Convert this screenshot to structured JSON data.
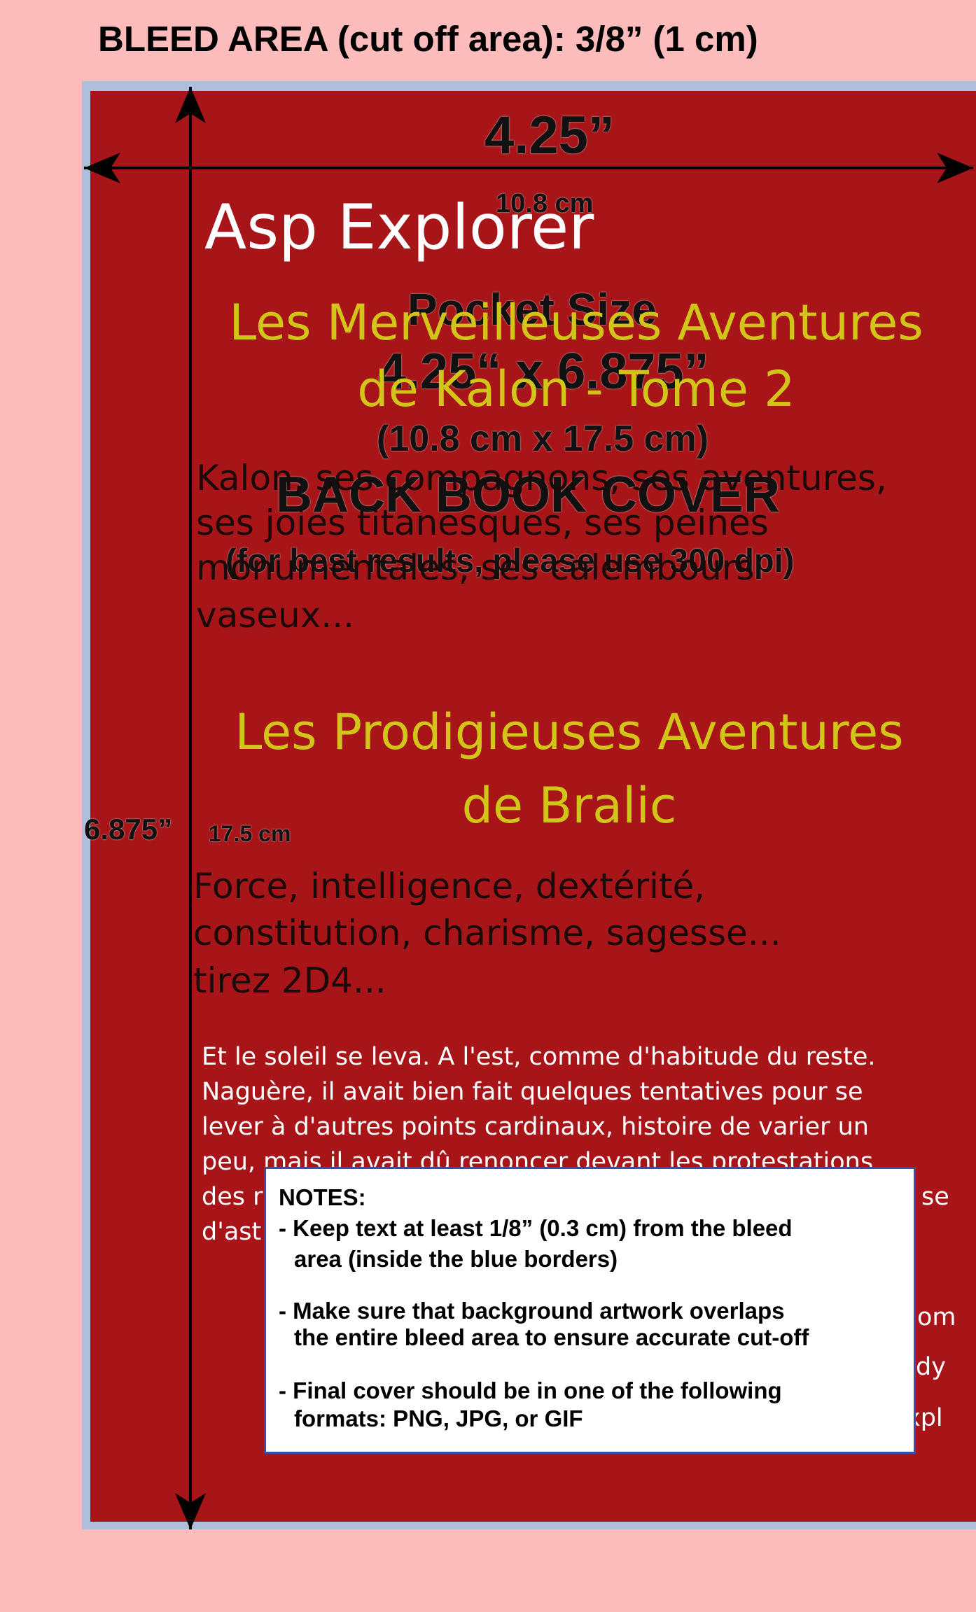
{
  "guide": {
    "bleed_title": "BLEED AREA (cut off area): 3/8” (1 cm)",
    "width_in": "4.25”",
    "width_cm": "10.8 cm",
    "pocket_size": "Pocket Size",
    "dimensions_in": "4.25“ x 6.875”",
    "dimensions_cm": "(10.8 cm x 17.5 cm)",
    "back_cover": "BACK BOOK COVER",
    "dpi_note": "(for best results, please use 300 dpi)",
    "height_in": "6.875”",
    "height_cm": "17.5 cm"
  },
  "cover": {
    "title": "Asp Explorer",
    "book1_title_line1": "Les Merveilleuses Aventures",
    "book1_title_line2": "de Kalon - Tome 2",
    "book1_blurb_line1": "Kalon, ses compagnons, ses aventures,",
    "book1_blurb_line2": "ses joies titanesques, ses peines",
    "book1_blurb_line3": "monumentales, ses calembours",
    "book1_blurb_line4": "vaseux...",
    "book2_title_line1": "Les Prodigieuses Aventures",
    "book2_title_line2": "de Bralic",
    "book2_blurb_line1": "Force, intelligence, dextérité,",
    "book2_blurb_line2": "constitution, charisme, sagesse...",
    "book2_blurb_line3": "tirez 2D4...",
    "excerpt_line1": "Et le soleil se leva. A l'est, comme d'habitude du reste.",
    "excerpt_line2": "Naguère, il avait bien fait quelques tentatives pour se",
    "excerpt_line3": "lever à d'autres points cardinaux, histoire de varier un",
    "excerpt_line4": "peu, mais il avait dû renoncer devant les protestations",
    "excerpt_line5_start": "des r",
    "excerpt_line5_end": "se",
    "excerpt_line6_start": "d'ast",
    "frag1": "om",
    "frag2": "dy",
    "frag3": "xpl"
  },
  "notes": {
    "heading": "NOTES:",
    "item1_line1": "- Keep text at least 1/8” (0.3 cm) from the bleed",
    "item1_line2": "area (inside the blue borders)",
    "item2_line1": "- Make sure that background artwork overlaps",
    "item2_line2": "the entire bleed area to ensure accurate cut-off",
    "item3_line1": "- Final cover should be in one of the following",
    "item3_line2": "formats:  PNG, JPG, or GIF"
  },
  "colors": {
    "page_background": "#fdbcbc",
    "bleed_band": "#aebfdc",
    "cover_red": "#a81518",
    "title_yellow": "#d2c51a"
  }
}
